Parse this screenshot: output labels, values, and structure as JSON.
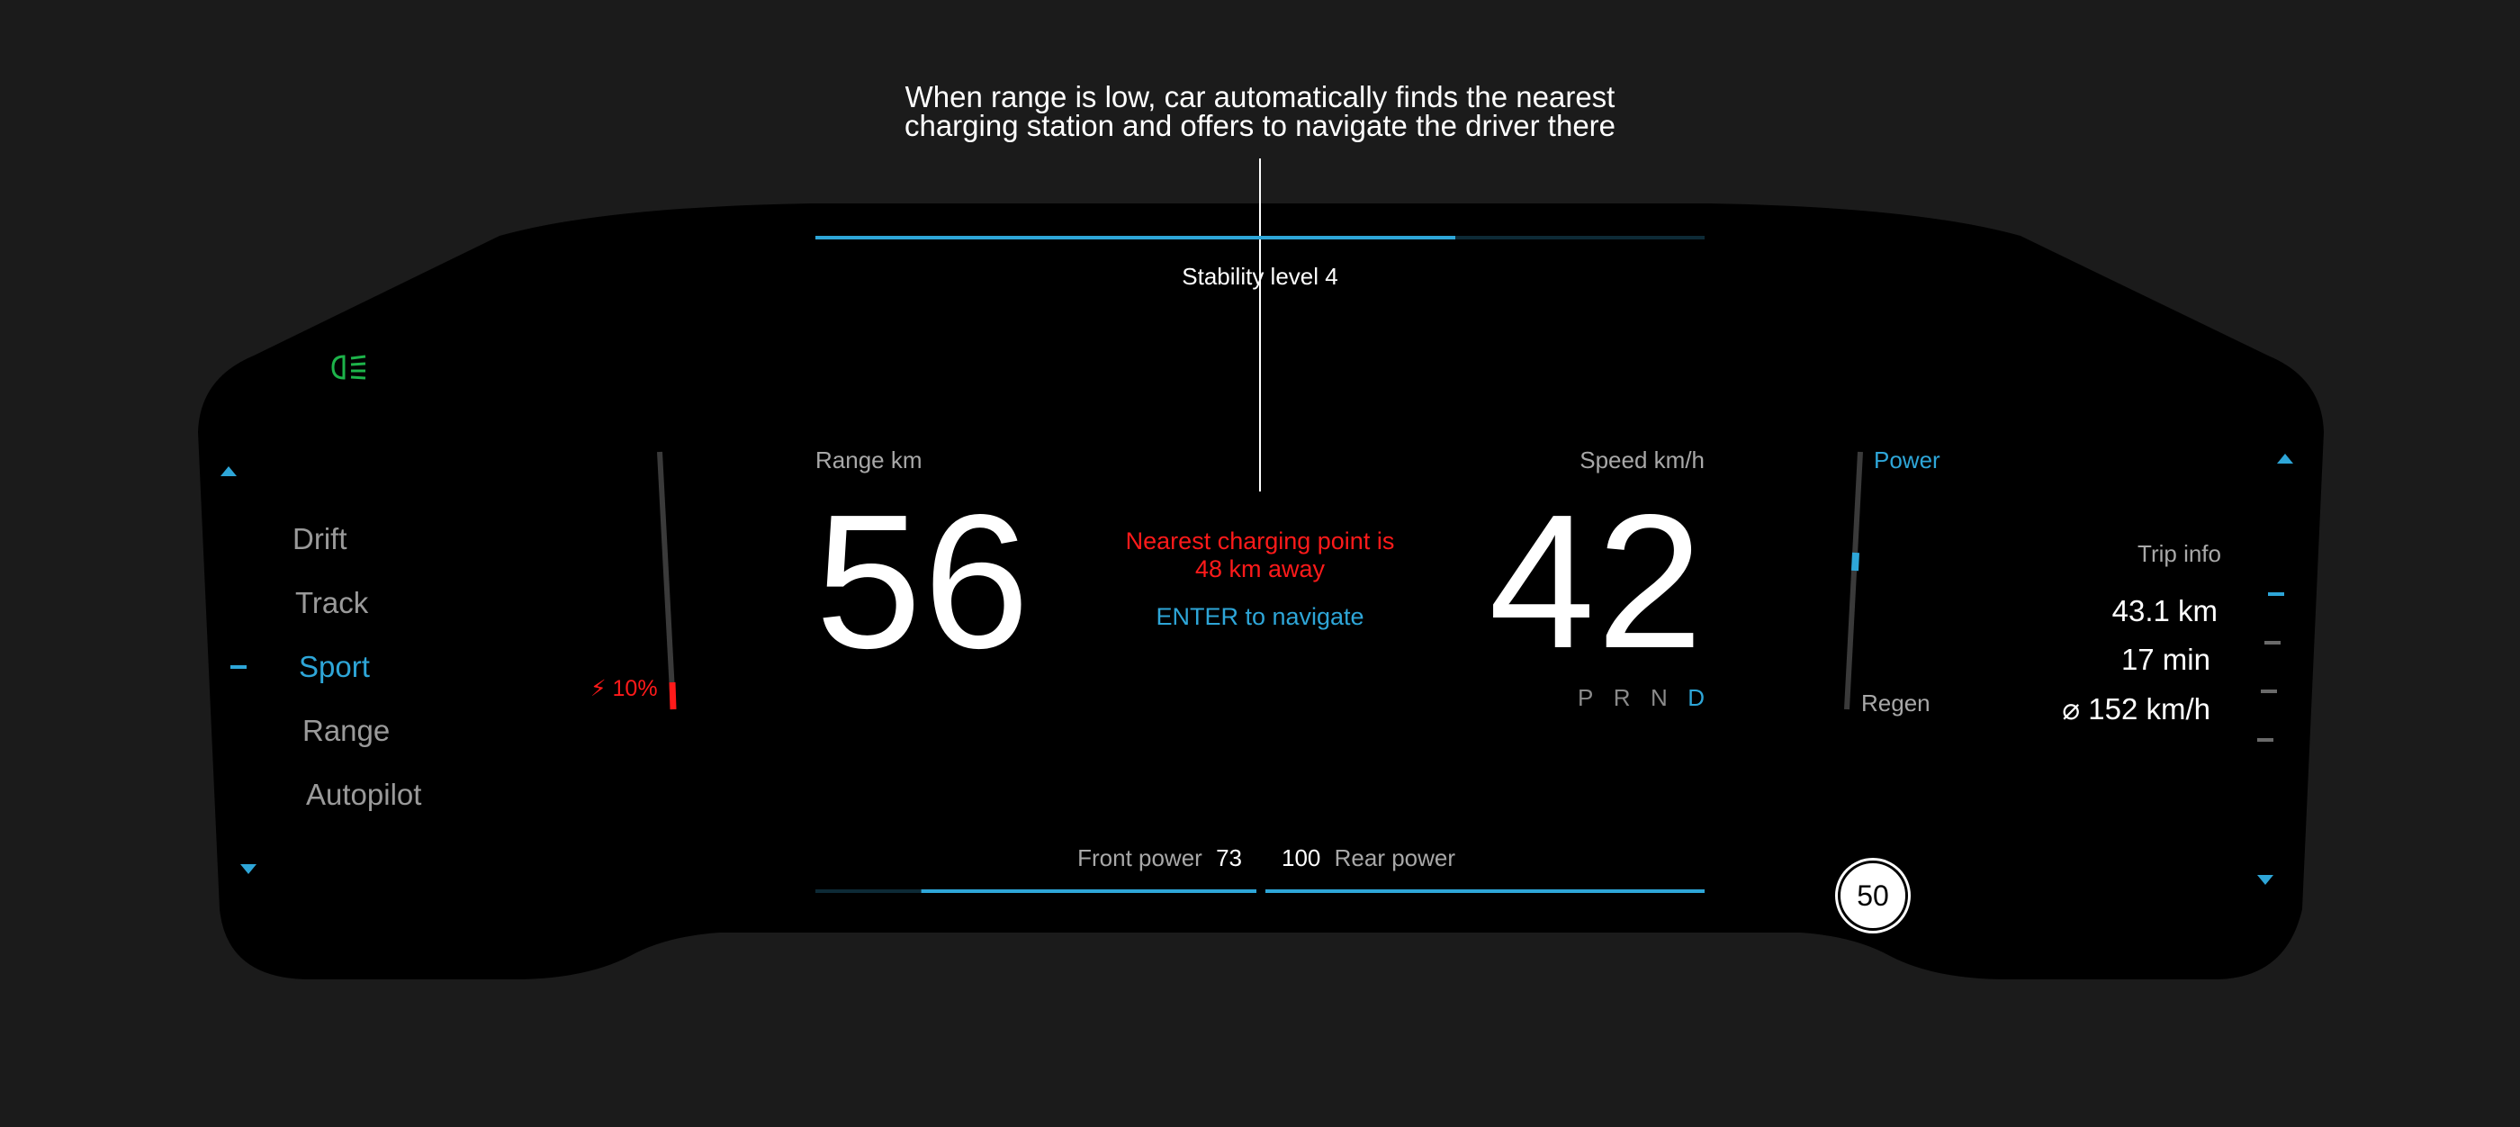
{
  "annotation": {
    "line1": "When range is low, car automatically finds the nearest",
    "line2": "charging station and offers to navigate the driver there"
  },
  "stability": {
    "label": "Stability level 4",
    "level_fraction": 0.72
  },
  "range": {
    "label": "Range km",
    "value": "56"
  },
  "speed": {
    "label": "Speed km/h",
    "value": "42"
  },
  "charging": {
    "message_line1": "Nearest charging point is",
    "message_line2": "48 km away",
    "navigate": "ENTER to navigate"
  },
  "battery": {
    "percent_label": "10%",
    "level_fraction": 0.1,
    "color": "#ff1a1a"
  },
  "modes": {
    "items": [
      {
        "label": "Drift"
      },
      {
        "label": "Track"
      },
      {
        "label": "Sport",
        "active": true
      },
      {
        "label": "Range"
      },
      {
        "label": "Autopilot"
      }
    ]
  },
  "gears": {
    "P": "P",
    "R": "R",
    "N": "N",
    "D": "D",
    "selected": "D"
  },
  "power_gauge": {
    "power_label": "Power",
    "regen_label": "Regen",
    "level_fraction": 0.4
  },
  "trip": {
    "title": "Trip info",
    "distance": "43.1 km",
    "time": "17 min",
    "avg_speed": "⌀ 152 km/h"
  },
  "power_split": {
    "front_label": "Front power",
    "front_value": "73",
    "rear_value": "100",
    "rear_label": "Rear power",
    "front_fraction": 0.73,
    "rear_fraction": 1.0
  },
  "speed_limit": "50",
  "icons": {
    "headlight": "low-beam-headlight-icon"
  },
  "colors": {
    "accent": "#2ea6d8",
    "warning": "#ff1a1a",
    "indicator": "#1db34a",
    "background": "#1b1b1b",
    "panel": "#000000"
  }
}
